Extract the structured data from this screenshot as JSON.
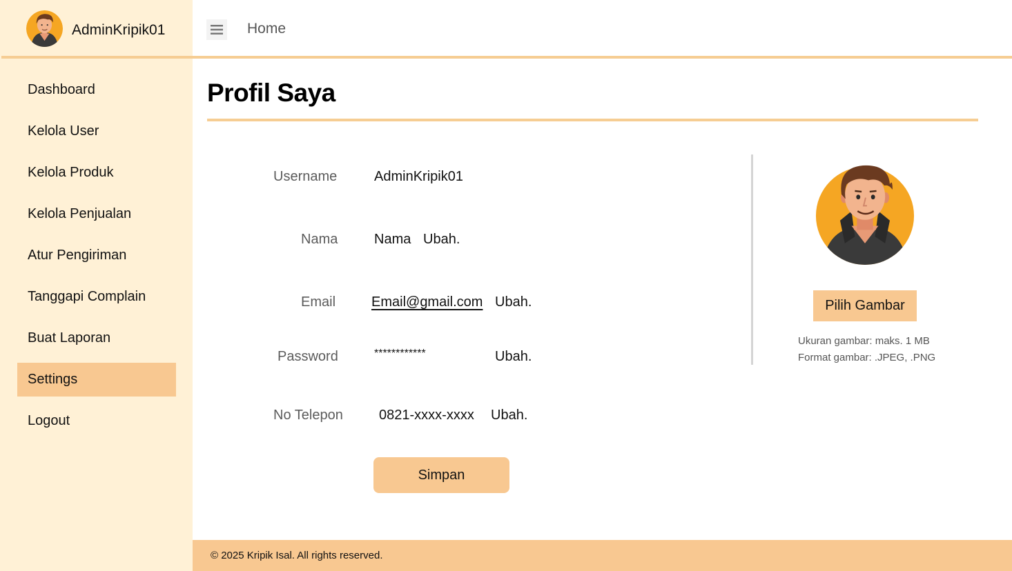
{
  "user": {
    "display_name": "AdminKripik01"
  },
  "header": {
    "menu_icon": "hamburger-menu-icon",
    "home_label": "Home"
  },
  "sidebar": {
    "items": [
      {
        "label": "Dashboard",
        "active": false
      },
      {
        "label": "Kelola User",
        "active": false
      },
      {
        "label": "Kelola Produk",
        "active": false
      },
      {
        "label": "Kelola Penjualan",
        "active": false
      },
      {
        "label": "Atur Pengiriman",
        "active": false
      },
      {
        "label": "Tanggapi Complain",
        "active": false
      },
      {
        "label": "Buat Laporan",
        "active": false
      },
      {
        "label": "Settings",
        "active": true
      },
      {
        "label": "Logout",
        "active": false
      }
    ]
  },
  "page": {
    "title": "Profil Saya"
  },
  "form": {
    "username": {
      "label": "Username",
      "value": "AdminKripik01"
    },
    "nama": {
      "label": "Nama",
      "value": "Nama",
      "edit_label": "Ubah."
    },
    "email": {
      "label": "Email",
      "value": "Email@gmail.com",
      "edit_label": "Ubah."
    },
    "password": {
      "label": "Password",
      "value": "************",
      "edit_label": "Ubah."
    },
    "phone": {
      "label": "No Telepon",
      "value": "0821-xxxx-xxxx",
      "edit_label": "Ubah."
    },
    "save_label": "Simpan"
  },
  "profile_image": {
    "pick_label": "Pilih Gambar",
    "size_hint": "Ukuran gambar: maks. 1 MB",
    "format_hint": "Format gambar: .JPEG, .PNG"
  },
  "footer": {
    "text": "© 2025 Kripik Isal. All rights reserved."
  },
  "colors": {
    "sidebar_bg": "#fff1d6",
    "accent": "#f8c891",
    "divider": "#f6cd93",
    "avatar_bg": "#f5a623"
  }
}
